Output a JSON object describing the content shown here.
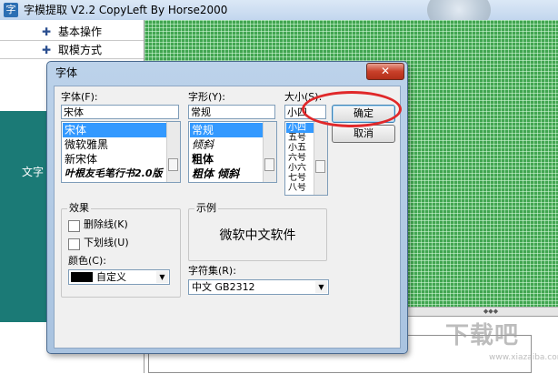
{
  "app": {
    "title": "字模提取 V2.2  CopyLeft By Horse2000",
    "icon_glyph": "字",
    "menu": [
      {
        "label": "基本操作"
      },
      {
        "label": "取模方式"
      }
    ],
    "side_label": "文字"
  },
  "dialog": {
    "title": "字体",
    "close_glyph": "✕",
    "font": {
      "label": "字体(F):",
      "value": "宋体",
      "items": [
        "宋体",
        "微软雅黑",
        "新宋体",
        "叶根友毛笔行书2.0版"
      ],
      "selected_index": 0
    },
    "style": {
      "label": "字形(Y):",
      "value": "常规",
      "items": [
        "常规",
        "倾斜",
        "粗体",
        "粗体 倾斜"
      ],
      "selected_index": 0
    },
    "size": {
      "label": "大小(S):",
      "value": "小四",
      "items": [
        "小四",
        "五号",
        "小五",
        "六号",
        "小六",
        "七号",
        "八号"
      ],
      "selected_index": 0
    },
    "ok_label": "确定",
    "cancel_label": "取消",
    "effects": {
      "title": "效果",
      "strikeout_label": "删除线(K)",
      "underline_label": "下划线(U)",
      "color_label": "颜色(C):",
      "color_value": "自定义",
      "color_swatch": "#000000"
    },
    "sample": {
      "title": "示例",
      "text": "微软中文软件"
    },
    "charset": {
      "label": "字符集(R):",
      "value": "中文 GB2312"
    }
  },
  "watermark": {
    "text": "下载吧",
    "url": "www.xiazaiba.com"
  },
  "colors": {
    "grid_green": "#41a550",
    "teal": "#1b7a76",
    "selection": "#3399ff",
    "highlight_ring": "#e0282a"
  }
}
